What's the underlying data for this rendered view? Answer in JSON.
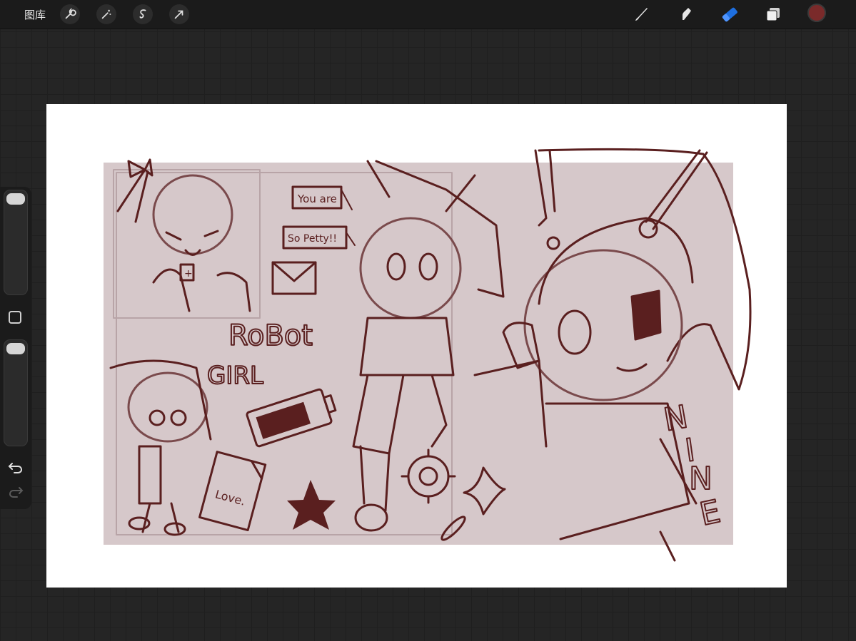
{
  "toolbar": {
    "gallery_label": "图库",
    "left_tools": [
      "wrench-icon",
      "magic-wand-icon",
      "selection-icon",
      "transform-arrow-icon"
    ],
    "right_tools": [
      "brush-icon",
      "smudge-icon",
      "eraser-icon",
      "layers-icon"
    ],
    "active_tool": "eraser",
    "active_tool_color": "#1e6fe0",
    "current_color": "#7a2a2a"
  },
  "sidebar": {
    "brush_size": 1.0,
    "opacity": 1.0
  },
  "canvas": {
    "background": "#ffffff",
    "panel_color": "#d6c8ca",
    "ink_color": "#5a1f1f",
    "text": {
      "speech1": "You are",
      "speech2": "So Petty!!",
      "robot": "RoBot",
      "girl": "GIRL",
      "love": "Love.",
      "nine": [
        "N",
        "I",
        "N",
        "E"
      ]
    }
  }
}
